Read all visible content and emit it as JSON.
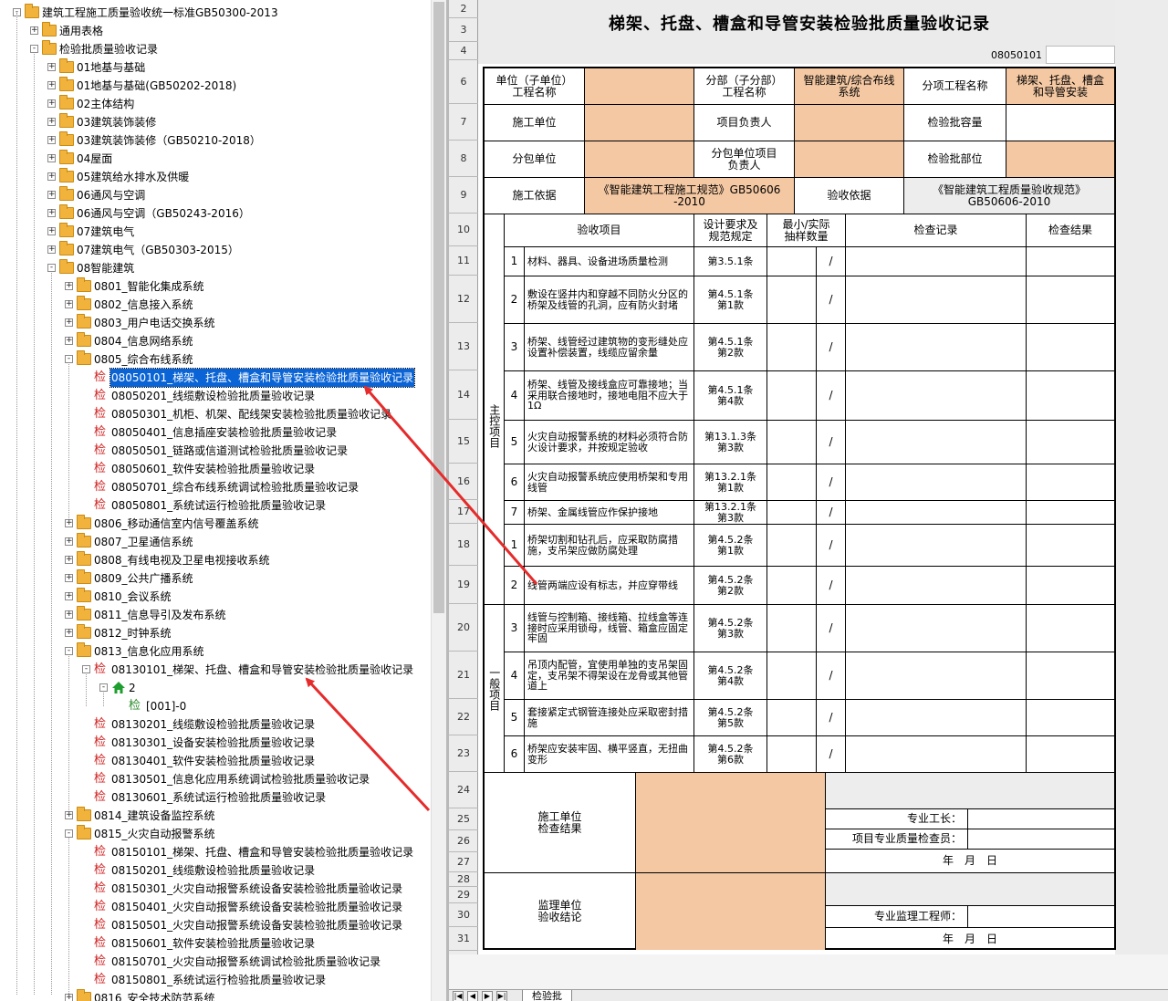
{
  "tree": {
    "root": "建筑工程施工质量验收统一标准GB50300-2013",
    "items": [
      {
        "label": "通用表格",
        "level": 1,
        "type": "folder",
        "exp": "+"
      },
      {
        "label": "检验批质量验收记录",
        "level": 1,
        "type": "folder",
        "exp": "-"
      },
      {
        "label": "01地基与基础",
        "level": 2,
        "type": "folder",
        "exp": "+"
      },
      {
        "label": "01地基与基础(GB50202-2018)",
        "level": 2,
        "type": "folder",
        "exp": "+"
      },
      {
        "label": "02主体结构",
        "level": 2,
        "type": "folder",
        "exp": "+"
      },
      {
        "label": "03建筑装饰装修",
        "level": 2,
        "type": "folder",
        "exp": "+"
      },
      {
        "label": "03建筑装饰装修（GB50210-2018）",
        "level": 2,
        "type": "folder",
        "exp": "+"
      },
      {
        "label": "04屋面",
        "level": 2,
        "type": "folder",
        "exp": "+"
      },
      {
        "label": "05建筑给水排水及供暖",
        "level": 2,
        "type": "folder",
        "exp": "+"
      },
      {
        "label": "06通风与空调",
        "level": 2,
        "type": "folder",
        "exp": "+"
      },
      {
        "label": "06通风与空调（GB50243-2016）",
        "level": 2,
        "type": "folder",
        "exp": "+"
      },
      {
        "label": "07建筑电气",
        "level": 2,
        "type": "folder",
        "exp": "+"
      },
      {
        "label": "07建筑电气（GB50303-2015）",
        "level": 2,
        "type": "folder",
        "exp": "+"
      },
      {
        "label": "08智能建筑",
        "level": 2,
        "type": "folder",
        "exp": "-"
      },
      {
        "label": "0801_智能化集成系统",
        "level": 3,
        "type": "folder",
        "exp": "+"
      },
      {
        "label": "0802_信息接入系统",
        "level": 3,
        "type": "folder",
        "exp": "+"
      },
      {
        "label": "0803_用户电话交换系统",
        "level": 3,
        "type": "folder",
        "exp": "+"
      },
      {
        "label": "0804_信息网络系统",
        "level": 3,
        "type": "folder",
        "exp": "+"
      },
      {
        "label": "0805_综合布线系统",
        "level": 3,
        "type": "folder",
        "exp": "-"
      },
      {
        "label": "08050101_梯架、托盘、槽盒和导管安装检验批质量验收记录",
        "level": 4,
        "type": "doc",
        "selected": true
      },
      {
        "label": "08050201_线缆敷设检验批质量验收记录",
        "level": 4,
        "type": "doc"
      },
      {
        "label": "08050301_机柜、机架、配线架安装检验批质量验收记录",
        "level": 4,
        "type": "doc"
      },
      {
        "label": "08050401_信息插座安装检验批质量验收记录",
        "level": 4,
        "type": "doc"
      },
      {
        "label": "08050501_链路或信道测试检验批质量验收记录",
        "level": 4,
        "type": "doc"
      },
      {
        "label": "08050601_软件安装检验批质量验收记录",
        "level": 4,
        "type": "doc"
      },
      {
        "label": "08050701_综合布线系统调试检验批质量验收记录",
        "level": 4,
        "type": "doc"
      },
      {
        "label": "08050801_系统试运行检验批质量验收记录",
        "level": 4,
        "type": "doc"
      },
      {
        "label": "0806_移动通信室内信号覆盖系统",
        "level": 3,
        "type": "folder",
        "exp": "+"
      },
      {
        "label": "0807_卫星通信系统",
        "level": 3,
        "type": "folder",
        "exp": "+"
      },
      {
        "label": "0808_有线电视及卫星电视接收系统",
        "level": 3,
        "type": "folder",
        "exp": "+"
      },
      {
        "label": "0809_公共广播系统",
        "level": 3,
        "type": "folder",
        "exp": "+"
      },
      {
        "label": "0810_会议系统",
        "level": 3,
        "type": "folder",
        "exp": "+"
      },
      {
        "label": "0811_信息导引及发布系统",
        "level": 3,
        "type": "folder",
        "exp": "+"
      },
      {
        "label": "0812_时钟系统",
        "level": 3,
        "type": "folder",
        "exp": "+"
      },
      {
        "label": "0813_信息化应用系统",
        "level": 3,
        "type": "folder",
        "exp": "-"
      },
      {
        "label": "08130101_梯架、托盘、槽盒和导管安装检验批质量验收记录",
        "level": 4,
        "type": "doc",
        "exp": "-"
      },
      {
        "label": "2",
        "level": 5,
        "type": "home",
        "exp": "-"
      },
      {
        "label": "[001]-0",
        "level": 6,
        "type": "doc2"
      },
      {
        "label": "08130201_线缆敷设检验批质量验收记录",
        "level": 4,
        "type": "doc"
      },
      {
        "label": "08130301_设备安装检验批质量验收记录",
        "level": 4,
        "type": "doc"
      },
      {
        "label": "08130401_软件安装检验批质量验收记录",
        "level": 4,
        "type": "doc"
      },
      {
        "label": "08130501_信息化应用系统调试检验批质量验收记录",
        "level": 4,
        "type": "doc"
      },
      {
        "label": "08130601_系统试运行检验批质量验收记录",
        "level": 4,
        "type": "doc"
      },
      {
        "label": "0814_建筑设备监控系统",
        "level": 3,
        "type": "folder",
        "exp": "+"
      },
      {
        "label": "0815_火灾自动报警系统",
        "level": 3,
        "type": "folder",
        "exp": "-"
      },
      {
        "label": "08150101_梯架、托盘、槽盒和导管安装检验批质量验收记录",
        "level": 4,
        "type": "doc"
      },
      {
        "label": "08150201_线缆敷设检验批质量验收记录",
        "level": 4,
        "type": "doc"
      },
      {
        "label": "08150301_火灾自动报警系统设备安装检验批质量验收记录",
        "level": 4,
        "type": "doc"
      },
      {
        "label": "08150401_火灾自动报警系统设备安装检验批质量验收记录",
        "level": 4,
        "type": "doc"
      },
      {
        "label": "08150501_火灾自动报警系统设备安装检验批质量验收记录",
        "level": 4,
        "type": "doc"
      },
      {
        "label": "08150601_软件安装检验批质量验收记录",
        "level": 4,
        "type": "doc"
      },
      {
        "label": "08150701_火灾自动报警系统调试检验批质量验收记录",
        "level": 4,
        "type": "doc"
      },
      {
        "label": "08150801_系统试运行检验批质量验收记录",
        "level": 4,
        "type": "doc"
      },
      {
        "label": "0816_安全技术防范系统",
        "level": 3,
        "type": "folder",
        "exp": "+"
      }
    ],
    "doc_glyph": "检"
  },
  "rows": [
    "2",
    "3",
    "4",
    "6",
    "7",
    "8",
    "9",
    "10",
    "11",
    "12",
    "13",
    "14",
    "15",
    "16",
    "17",
    "18",
    "19",
    "20",
    "21",
    "22",
    "23",
    "24",
    "25",
    "26",
    "27",
    "28",
    "29",
    "30",
    "31"
  ],
  "form": {
    "title": "梯架、托盘、槽盒和导管安装检验批质量验收记录",
    "code": "08050101",
    "unit_label": "单位（子单位）\n工程名称",
    "fenbu_label": "分部（子分部）\n工程名称",
    "fenbu_value": "智能建筑/综合布线\n系统",
    "fenxiang_label": "分项工程名称",
    "fenxiang_value": "梯架、托盘、槽盒\n和导管安装",
    "sg_unit_label": "施工单位",
    "pm_label": "项目负责人",
    "capacity_label": "检验批容量",
    "fb_unit_label": "分包单位",
    "fb_pm_label": "分包单位项目\n负责人",
    "position_label": "检验批部位",
    "basis_label": "施工依据",
    "basis_value": "《智能建筑工程施工规范》GB50606\n-2010",
    "accept_basis_label": "验收依据",
    "accept_basis_value": "《智能建筑工程质量验收规范》\nGB50606-2010",
    "h_item": "验收项目",
    "h_req": "设计要求及\n规范规定",
    "h_sample": "最小/实际\n抽样数量",
    "h_record": "检查记录",
    "h_result": "检查结果",
    "main_label": "主控项目",
    "general_label": "一般项目",
    "slash": "/",
    "main_items": [
      {
        "no": "1",
        "text": "材料、器具、设备进场质量检测",
        "req": "第3.5.1条"
      },
      {
        "no": "2",
        "text": "敷设在竖井内和穿越不同防火分区的桥架及线管的孔洞，应有防火封堵",
        "req": "第4.5.1条\n第1款"
      },
      {
        "no": "3",
        "text": "桥架、线管经过建筑物的变形缝处应设置补偿装置，线缆应留余量",
        "req": "第4.5.1条\n第2款"
      },
      {
        "no": "4",
        "text": "桥架、线管及接线盒应可靠接地；当采用联合接地时，接地电阻不应大于1Ω",
        "req": "第4.5.1条\n第4款"
      },
      {
        "no": "5",
        "text": "火灾自动报警系统的材料必须符合防火设计要求，并按规定验收",
        "req": "第13.1.3条\n第3款"
      },
      {
        "no": "6",
        "text": "火灾自动报警系统应使用桥架和专用线管",
        "req": "第13.2.1条\n第1款"
      },
      {
        "no": "7",
        "text": "桥架、金属线管应作保护接地",
        "req": "第13.2.1条\n第3款"
      }
    ],
    "general_items": [
      {
        "no": "1",
        "text": "桥架切割和钻孔后，应采取防腐措施，支吊架应做防腐处理",
        "req": "第4.5.2条\n第1款"
      },
      {
        "no": "2",
        "text": "线管两端应设有标志，并应穿带线",
        "req": "第4.5.2条\n第2款"
      },
      {
        "no": "3",
        "text": "线管与控制箱、接线箱、拉线盒等连接时应采用锁母，线管、箱盒应固定牢固",
        "req": "第4.5.2条\n第3款"
      },
      {
        "no": "4",
        "text": "吊顶内配管，宜使用单独的支吊架固定，支吊架不得架设在龙骨或其他管道上",
        "req": "第4.5.2条\n第4款"
      },
      {
        "no": "5",
        "text": "套接紧定式钢管连接处应采取密封措施",
        "req": "第4.5.2条\n第5款"
      },
      {
        "no": "6",
        "text": "桥架应安装牢固、横平竖直，无扭曲变形",
        "req": "第4.5.2条\n第6款"
      }
    ],
    "sg_check_label": "施工单位\n检查结果",
    "foreman_label": "专业工长：",
    "inspector_label": "项目专业质量检查员：",
    "date_label": "年　月　日",
    "jl_label": "监理单位\n验收结论",
    "jl_engineer_label": "专业监理工程师："
  },
  "sheet_tab": "检验批"
}
